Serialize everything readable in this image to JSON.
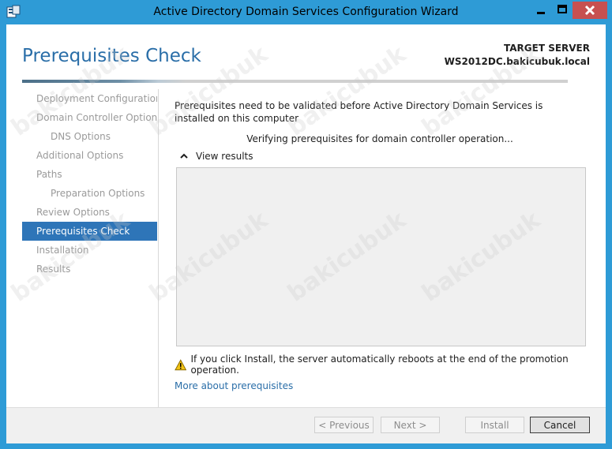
{
  "window": {
    "title": "Active Directory Domain Services Configuration Wizard"
  },
  "header": {
    "page_title": "Prerequisites Check",
    "target_label": "TARGET SERVER",
    "target_name": "WS2012DC.bakicubuk.local"
  },
  "nav": {
    "items": [
      {
        "label": "Deployment Configuration"
      },
      {
        "label": "Domain Controller Options"
      },
      {
        "label": "DNS Options"
      },
      {
        "label": "Additional Options"
      },
      {
        "label": "Paths"
      },
      {
        "label": "Preparation Options"
      },
      {
        "label": "Review Options"
      },
      {
        "label": "Prerequisites Check"
      },
      {
        "label": "Installation"
      },
      {
        "label": "Results"
      }
    ]
  },
  "main": {
    "intro": "Prerequisites need to be validated before Active Directory Domain Services is installed on this computer",
    "verifying": "Verifying prerequisites for domain controller operation...",
    "view_results": "View results",
    "warning": "If you click Install, the server automatically reboots at the end of the promotion operation.",
    "more_link": "More about prerequisites"
  },
  "footer": {
    "previous": "< Previous",
    "next": "Next >",
    "install": "Install",
    "cancel": "Cancel"
  },
  "watermark": "bakicubuk",
  "colors": {
    "accent": "#2e9bd6",
    "title_blue": "#2a6ea8",
    "selected_nav": "#2e75b8",
    "close_button": "#c75050"
  }
}
